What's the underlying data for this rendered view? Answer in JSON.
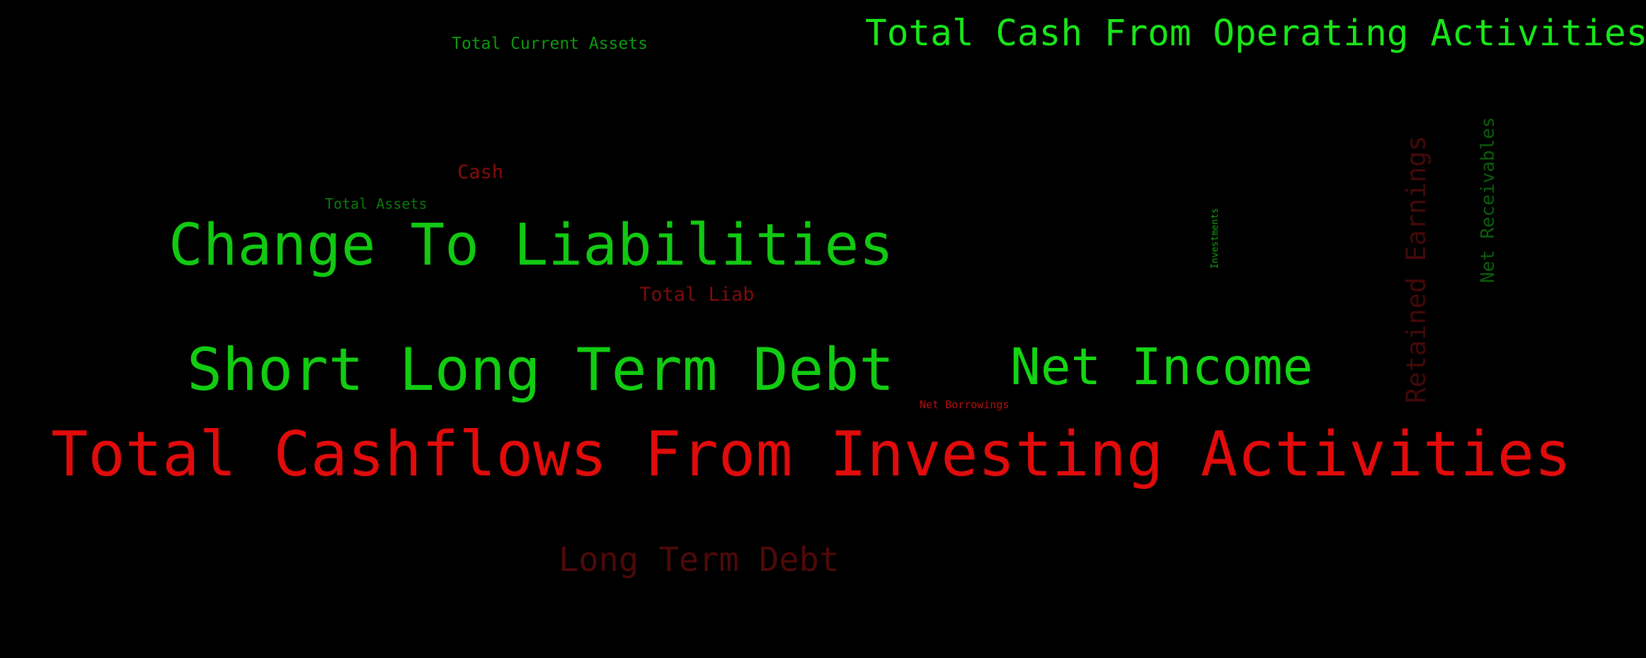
{
  "background": "#000000",
  "words": [
    {
      "text": "Total Cash From Operating Activities",
      "color": "#19e619"
    },
    {
      "text": "Total Current Assets",
      "color": "#0e9a0e"
    },
    {
      "text": "Cash",
      "color": "#8a0b0b"
    },
    {
      "text": "Total Assets",
      "color": "#0b7a0b"
    },
    {
      "text": "Change To Liabilities",
      "color": "#12c812"
    },
    {
      "text": "Total Liab",
      "color": "#7e0c0c"
    },
    {
      "text": "Short Long Term Debt",
      "color": "#12cc12"
    },
    {
      "text": "Net Income",
      "color": "#14d414"
    },
    {
      "text": "Net Borrowings",
      "color": "#b60f0f"
    },
    {
      "text": "Total Cashflows From Investing Activities",
      "color": "#e00b0b"
    },
    {
      "text": "Long Term Debt",
      "color": "#4e0909"
    },
    {
      "text": "Retained Earnings",
      "color": "#430909"
    },
    {
      "text": "Net Receivables",
      "color": "#0a5e0a"
    },
    {
      "text": "Investments",
      "color": "#10a010"
    }
  ]
}
